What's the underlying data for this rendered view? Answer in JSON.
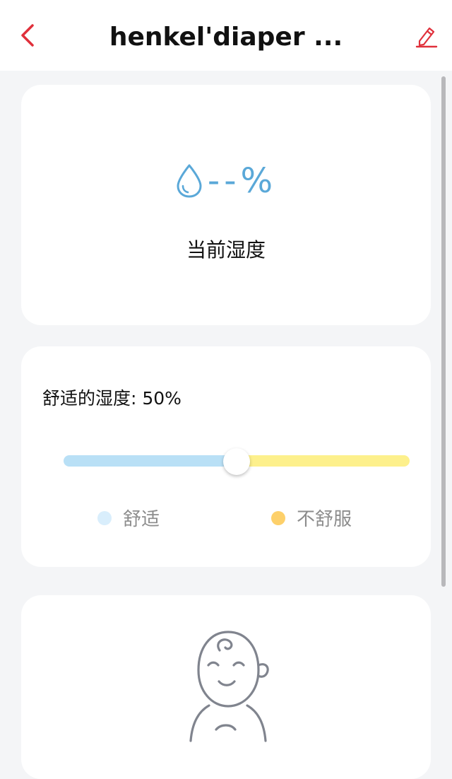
{
  "header": {
    "title": "henkel'diaper ..."
  },
  "humidity": {
    "value": "--%",
    "label": "当前湿度"
  },
  "comfort": {
    "title": "舒适的湿度: 50%",
    "slider_value_percent": 50,
    "legend": [
      {
        "label": "舒适",
        "color": "#d9eefc"
      },
      {
        "label": "不舒服",
        "color": "#fdd06a"
      }
    ]
  },
  "colors": {
    "accent_red": "#e0303b",
    "humidity_blue": "#5aa8d8",
    "track_comfy": "#b9e0f6",
    "track_uncomfy": "#fdf08c"
  },
  "icons": {
    "back": "chevron-left-icon",
    "edit": "pencil-icon",
    "humidity": "water-drop-icon",
    "baby": "baby-icon"
  }
}
